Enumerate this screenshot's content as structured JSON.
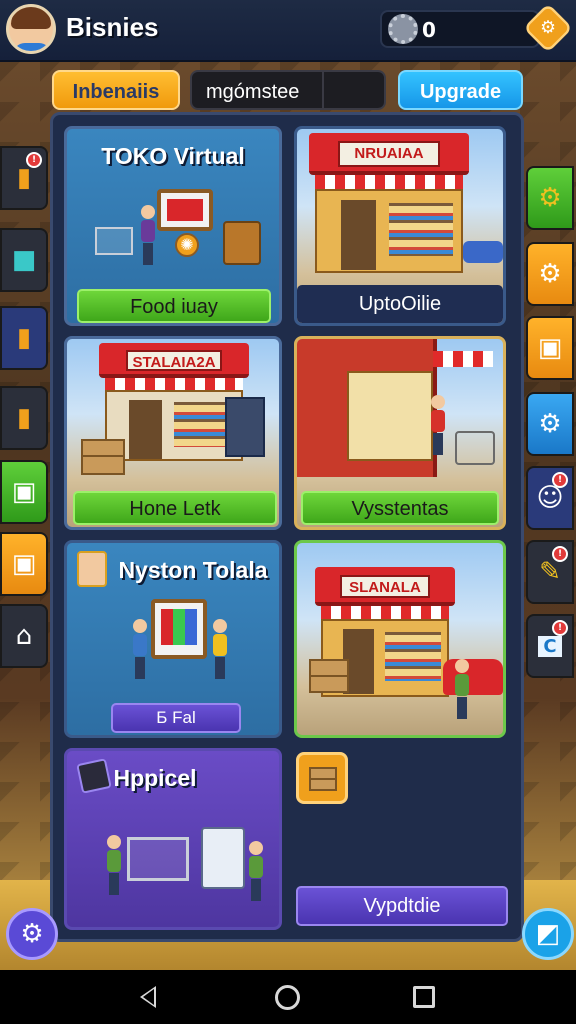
{
  "header": {
    "title": "Bisnies",
    "coins": "0"
  },
  "tabs": [
    {
      "label": "Inbenaiis"
    },
    {
      "label": "mgómstee"
    },
    {
      "label": "Upgrade"
    }
  ],
  "cards": [
    {
      "title": "TOKO Virtual",
      "button": "Food iuay"
    },
    {
      "sign": "NRUAIAA",
      "button": "UptoOilie"
    },
    {
      "sign": "STALAIA2A",
      "button": "Hone Letk"
    },
    {
      "button": "Vysstentas"
    },
    {
      "title": "Nyston Tolala",
      "button": "Б Fal"
    },
    {
      "sign": "SLANALA"
    },
    {
      "title": "Hppicel"
    }
  ],
  "update_button": "Vypdtdie",
  "icons": {
    "coin": "gear-icon",
    "right_corner": "hexagon-settings-icon",
    "fab_left": "settings-icon",
    "fab_right": "edit-icon"
  },
  "colors": {
    "accent_orange": "#f0a01c",
    "accent_blue": "#1696e8",
    "button_green": "#3fa71a",
    "panel": "#1f2c4a"
  }
}
